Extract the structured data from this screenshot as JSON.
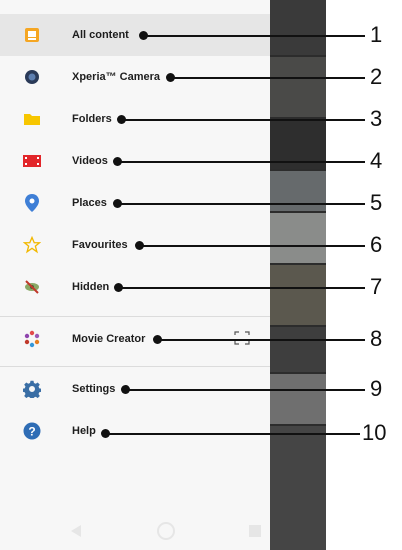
{
  "menu": {
    "items": [
      {
        "label": "All content",
        "icon": "all-content-icon"
      },
      {
        "label": "Xperia™ Camera",
        "icon": "camera-icon"
      },
      {
        "label": "Folders",
        "icon": "folder-icon"
      },
      {
        "label": "Videos",
        "icon": "video-icon"
      },
      {
        "label": "Places",
        "icon": "location-pin-icon"
      },
      {
        "label": "Favourites",
        "icon": "star-icon"
      },
      {
        "label": "Hidden",
        "icon": "hidden-icon"
      },
      {
        "label": "Movie Creator",
        "icon": "movie-creator-icon"
      },
      {
        "label": "Settings",
        "icon": "gear-icon"
      },
      {
        "label": "Help",
        "icon": "help-icon"
      }
    ],
    "selected": "All content"
  },
  "callouts": [
    "1",
    "2",
    "3",
    "4",
    "5",
    "6",
    "7",
    "8",
    "9",
    "10"
  ],
  "navbar": {
    "buttons": [
      "back-icon",
      "home-icon",
      "recents-icon"
    ]
  },
  "colors": {
    "accent_orange": "#f5a623",
    "folder_yellow": "#f7c600",
    "video_red": "#e2262a",
    "settings_blue": "#3a6ea5",
    "help_blue": "#2f6db5",
    "drawer_bg": "#f7f7f7",
    "active_bg": "#e6e6e6"
  }
}
